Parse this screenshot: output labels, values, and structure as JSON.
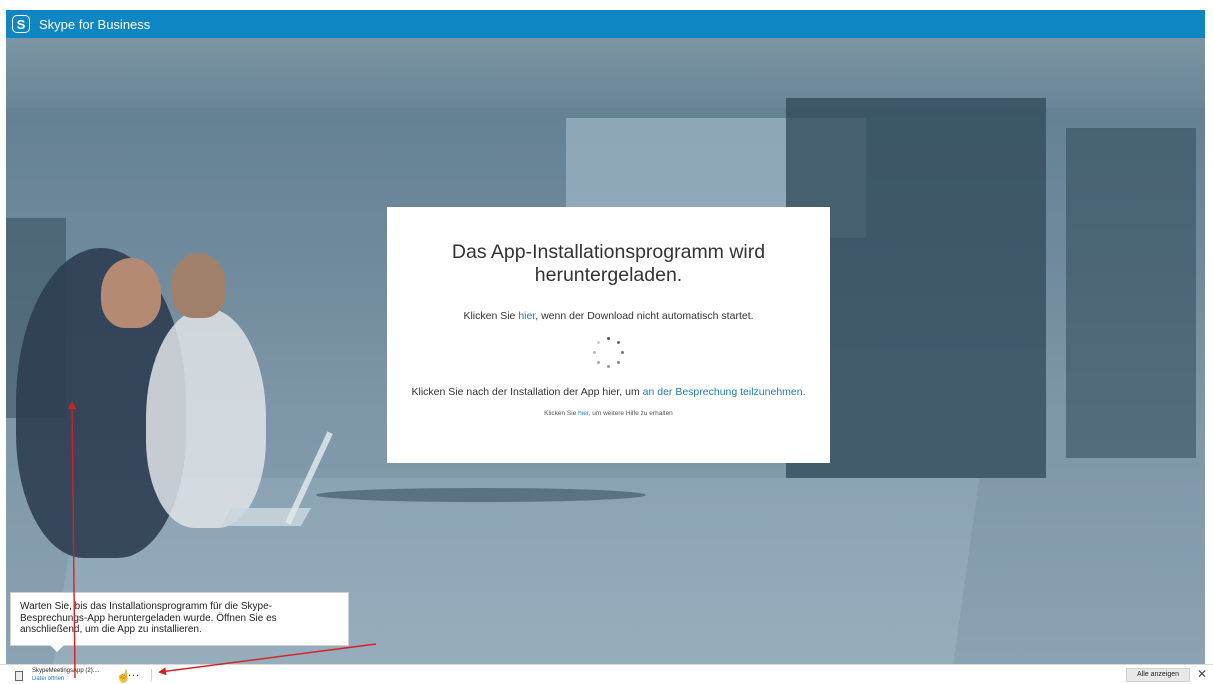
{
  "app": {
    "title": "Skype for Business",
    "logo_letter": "S"
  },
  "dialog": {
    "title": "Das App-Installationsprogramm wird heruntergeladen.",
    "line1_prefix": "Klicken Sie ",
    "line1_link": "hier",
    "line1_suffix": ", wenn der Download nicht automatisch startet.",
    "line2_prefix": "Klicken Sie nach der Installation der App hier, um ",
    "line2_link": "an der Besprechung teilzunehmen.",
    "line3_prefix": "Klicken Sie ",
    "line3_link": "hier",
    "line3_suffix": ", um weitere Hilfe zu erhalten"
  },
  "tooltip": {
    "text": "Warten Sie, bis das Installationsprogramm für die Skype-Besprechungs-App heruntergeladen wurde. Öffnen Sie es anschließend, um die App zu installieren."
  },
  "download_bar": {
    "file_name": "SkypeMeetingsApp (2)....",
    "file_status": "Datei öffnen",
    "more_label": "...",
    "show_all_label": "Alle anzeigen",
    "close_label": "✕"
  },
  "annotation": {
    "arrow_color": "#d62020"
  }
}
